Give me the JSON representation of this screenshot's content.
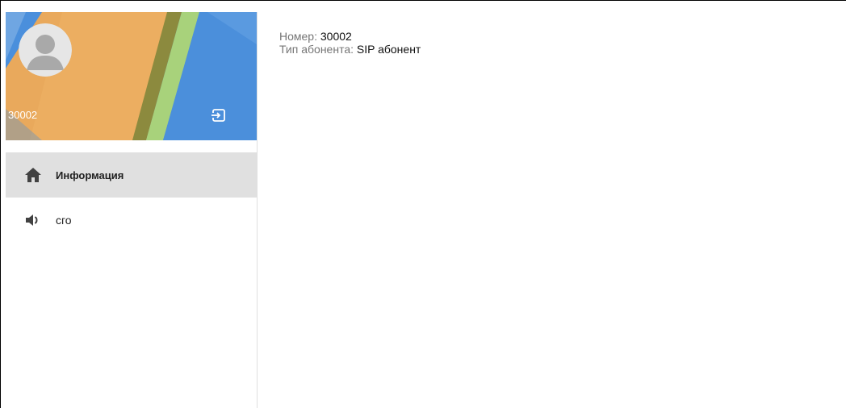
{
  "user": {
    "number": "30002"
  },
  "nav": {
    "items": [
      {
        "label": "Информация",
        "icon": "home-icon",
        "active": true
      },
      {
        "label": "сго",
        "icon": "speaker-icon",
        "active": false
      }
    ]
  },
  "info": {
    "number_label": "Номер:",
    "number_value": "30002",
    "type_label": "Тип абонента:",
    "type_value": "SIP абонент"
  },
  "colors": {
    "blue": "#4a90d9",
    "orange": "#e6a859",
    "green": "#a9d37d",
    "active_bg": "#e0e0e0"
  }
}
